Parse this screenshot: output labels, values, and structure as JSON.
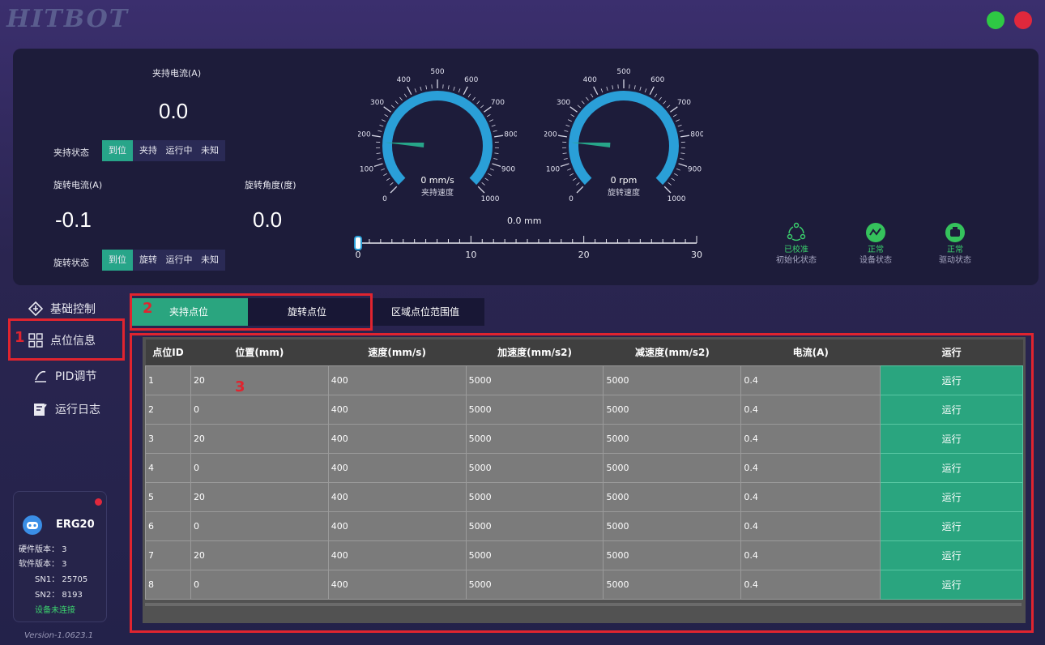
{
  "app": {
    "logo": "HITBOT"
  },
  "window_controls": {
    "green": "#2ec944",
    "red": "#e1283c"
  },
  "status_panel": {
    "clamp_current_label": "夹持电流(A)",
    "clamp_current_value": "0.0",
    "clamp_state_label": "夹持状态",
    "clamp_states": [
      "到位",
      "夹持",
      "运行中",
      "未知"
    ],
    "rotate_current_label": "旋转电流(A)",
    "rotate_current_value": "-0.1",
    "rotate_angle_label": "旋转角度(度)",
    "rotate_angle_value": "0.0",
    "rotate_state_label": "旋转状态",
    "rotate_states": [
      "到位",
      "旋转",
      "运行中",
      "未知"
    ],
    "active_color": "#27a589"
  },
  "gauges": {
    "ticks": [
      "0",
      "100",
      "200",
      "300",
      "400",
      "500",
      "600",
      "700",
      "800",
      "900",
      "1000"
    ],
    "clamp_speed": {
      "value": "0 mm/s",
      "label": "夹持速度",
      "level": 0.18
    },
    "rotate_speed": {
      "value": "0 rpm",
      "label": "旋转速度",
      "level": 0.18
    }
  },
  "position_slider": {
    "value_text": "0.0 mm",
    "ticks": [
      "0",
      "10",
      "20",
      "30"
    ],
    "value": 0
  },
  "status_icons": [
    {
      "icon": "calibration-icon",
      "line1": "已校准",
      "line2": "初始化状态"
    },
    {
      "icon": "device-status-icon",
      "line1": "正常",
      "line2": "设备状态"
    },
    {
      "icon": "driver-status-icon",
      "line1": "正常",
      "line2": "驱动状态"
    }
  ],
  "sidebar": {
    "items": [
      {
        "label": "基础控制",
        "icon": "basic-control-icon"
      },
      {
        "label": "点位信息",
        "icon": "grid-icon"
      },
      {
        "label": "PID调节",
        "icon": "pid-icon"
      },
      {
        "label": "运行日志",
        "icon": "log-icon"
      }
    ]
  },
  "device": {
    "name": "ERG20",
    "hardware_version": "硬件版本： 3",
    "software_version": "软件版本： 3",
    "sn1": "SN1： 25705",
    "sn2": "SN2： 8193",
    "connection": "设备未连接",
    "version": "Version-1.0623.1"
  },
  "tabs": [
    "夹持点位",
    "旋转点位",
    "区域点位范围值"
  ],
  "annotations": [
    "1",
    "2",
    "3"
  ],
  "table": {
    "columns": [
      "点位ID",
      "位置(mm)",
      "速度(mm/s)",
      "加速度(mm/s2)",
      "减速度(mm/s2)",
      "电流(A)",
      "运行"
    ],
    "run_label": "运行",
    "rows": [
      [
        "1",
        "20",
        "400",
        "5000",
        "5000",
        "0.4"
      ],
      [
        "2",
        "0",
        "400",
        "5000",
        "5000",
        "0.4"
      ],
      [
        "3",
        "20",
        "400",
        "5000",
        "5000",
        "0.4"
      ],
      [
        "4",
        "0",
        "400",
        "5000",
        "5000",
        "0.4"
      ],
      [
        "5",
        "20",
        "400",
        "5000",
        "5000",
        "0.4"
      ],
      [
        "6",
        "0",
        "400",
        "5000",
        "5000",
        "0.4"
      ],
      [
        "7",
        "20",
        "400",
        "5000",
        "5000",
        "0.4"
      ],
      [
        "8",
        "0",
        "400",
        "5000",
        "5000",
        "0.4"
      ]
    ]
  }
}
